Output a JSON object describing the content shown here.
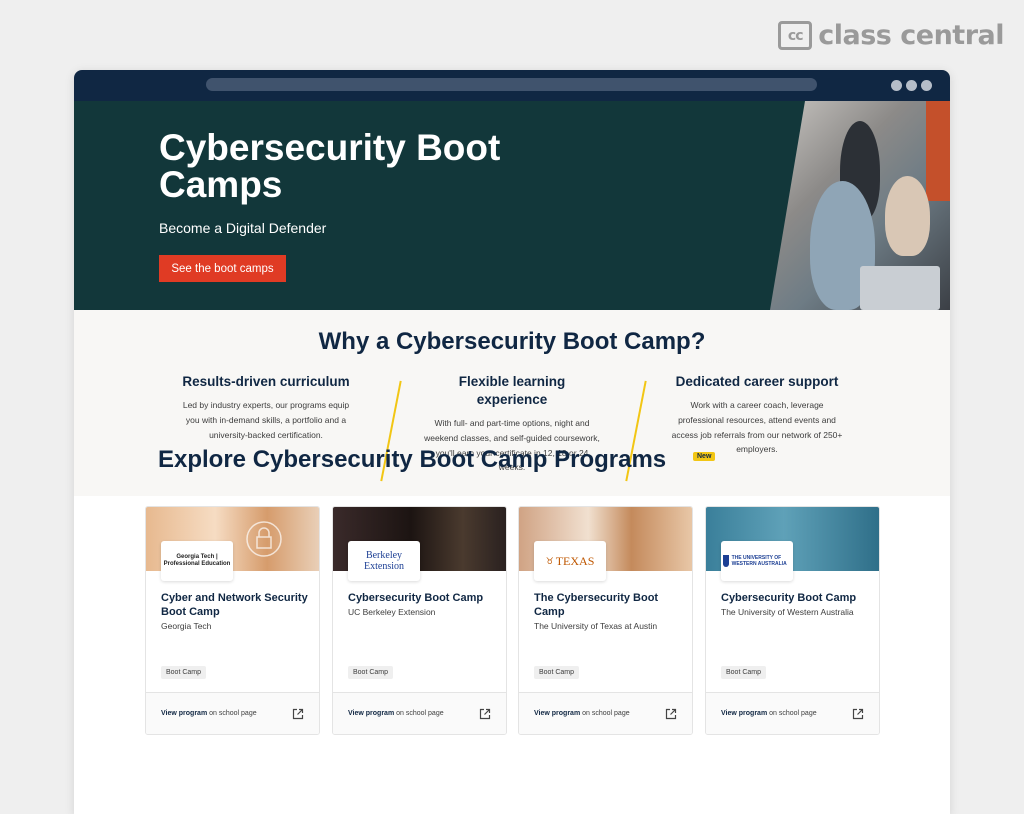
{
  "brand": {
    "logo_mark": "cc",
    "logo_text": "class central"
  },
  "hero": {
    "title": "Cybersecurity Boot Camps",
    "subtitle": "Become a Digital Defender",
    "cta": "See the boot camps"
  },
  "why": {
    "title": "Why a Cybersecurity Boot Camp?",
    "features": [
      {
        "title": "Results-driven curriculum",
        "description": "Led by industry experts, our programs equip you with in-demand skills, a portfolio and a university-backed certification."
      },
      {
        "title": "Flexible learning experience",
        "description": "With full- and part-time options, night and weekend classes, and self-guided coursework, you'll earn your certificate in 12, 18 or 24 weeks."
      },
      {
        "title": "Dedicated career support",
        "description": "Work with a career coach, leverage professional resources, attend events and access job referrals from our network of 250+ employers."
      }
    ]
  },
  "explore": {
    "title": "Explore Cybersecurity Boot Camp Programs",
    "badge": "New",
    "cards": [
      {
        "logo": "Georgia Tech | Professional Education",
        "title": "Cyber and Network Security Boot Camp",
        "school": "Georgia Tech",
        "tag": "Boot Camp",
        "link_bold": "View program",
        "link_rest": " on school page"
      },
      {
        "logo": "Berkeley Extension",
        "title": "Cybersecurity Boot Camp",
        "school": "UC Berkeley Extension",
        "tag": "Boot Camp",
        "link_bold": "View program",
        "link_rest": " on school page"
      },
      {
        "logo": "TEXAS",
        "title": "The Cybersecurity Boot Camp",
        "school": "The University of Texas at Austin",
        "tag": "Boot Camp",
        "link_bold": "View program",
        "link_rest": " on school page"
      },
      {
        "logo": "THE UNIVERSITY OF WESTERN AUSTRALIA",
        "title": "Cybersecurity Boot Camp",
        "school": "The University of Western Australia",
        "tag": "Boot Camp",
        "link_bold": "View program",
        "link_rest": " on school page"
      }
    ]
  },
  "colors": {
    "hero_bg": "#12373a",
    "accent_red": "#e03b24",
    "accent_yellow": "#f2c614",
    "navy": "#102743"
  },
  "icons": [
    "external-link-icon",
    "lock-icon",
    "texas-longhorn-icon",
    "uwa-crest-icon"
  ]
}
